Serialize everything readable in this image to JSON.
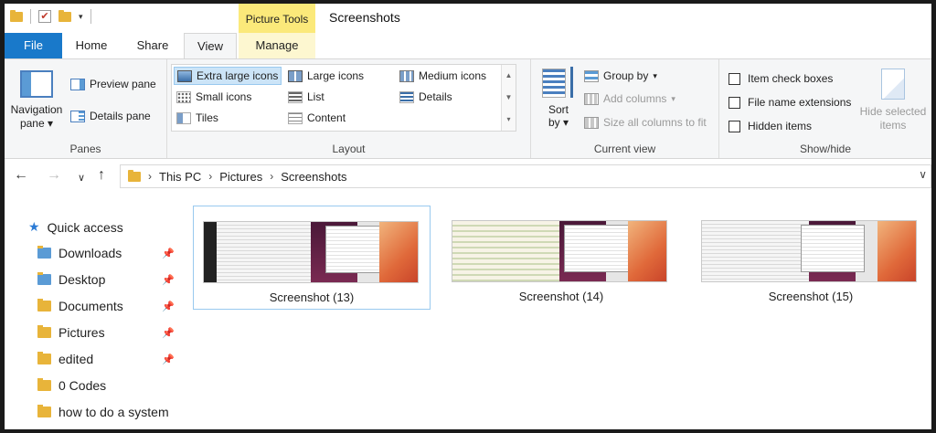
{
  "titlebar": {
    "context_tab": "Picture Tools",
    "window_title": "Screenshots"
  },
  "tabs": {
    "file": "File",
    "home": "Home",
    "share": "Share",
    "view": "View",
    "manage": "Manage"
  },
  "ribbon": {
    "panes": {
      "navigation_pane_line1": "Navigation",
      "navigation_pane_line2": "pane",
      "preview_pane": "Preview pane",
      "details_pane": "Details pane",
      "label": "Panes"
    },
    "layout": {
      "extra_large_icons": "Extra large icons",
      "large_icons": "Large icons",
      "medium_icons": "Medium icons",
      "small_icons": "Small icons",
      "list": "List",
      "details": "Details",
      "tiles": "Tiles",
      "content": "Content",
      "label": "Layout",
      "selected": "Extra large icons"
    },
    "current_view": {
      "sort_by_line1": "Sort",
      "sort_by_line2": "by",
      "group_by": "Group by",
      "add_columns": "Add columns",
      "size_all_columns": "Size all columns to fit",
      "label": "Current view"
    },
    "show_hide": {
      "item_check_boxes": "Item check boxes",
      "file_name_extensions": "File name extensions",
      "hidden_items": "Hidden items",
      "hide_selected_line1": "Hide selected",
      "hide_selected_line2": "items",
      "label": "Show/hide"
    }
  },
  "address": {
    "crumbs": [
      "This PC",
      "Pictures",
      "Screenshots"
    ]
  },
  "navpane": {
    "quick_access": "Quick access",
    "items": [
      {
        "label": "Downloads",
        "pinned": true
      },
      {
        "label": "Desktop",
        "pinned": true
      },
      {
        "label": "Documents",
        "pinned": true
      },
      {
        "label": "Pictures",
        "pinned": true
      },
      {
        "label": "edited",
        "pinned": true
      },
      {
        "label": "0 Codes",
        "pinned": false
      },
      {
        "label": "how to do a system",
        "pinned": false
      }
    ]
  },
  "files": [
    {
      "name": "Screenshot (13)",
      "selected": true
    },
    {
      "name": "Screenshot (14)",
      "selected": false
    },
    {
      "name": "Screenshot (15)",
      "selected": false
    }
  ],
  "colors": {
    "file_tab": "#1979ca",
    "picture_tools": "#fbe97a",
    "selection": "#cce4f7",
    "folder": "#e8b43a"
  }
}
